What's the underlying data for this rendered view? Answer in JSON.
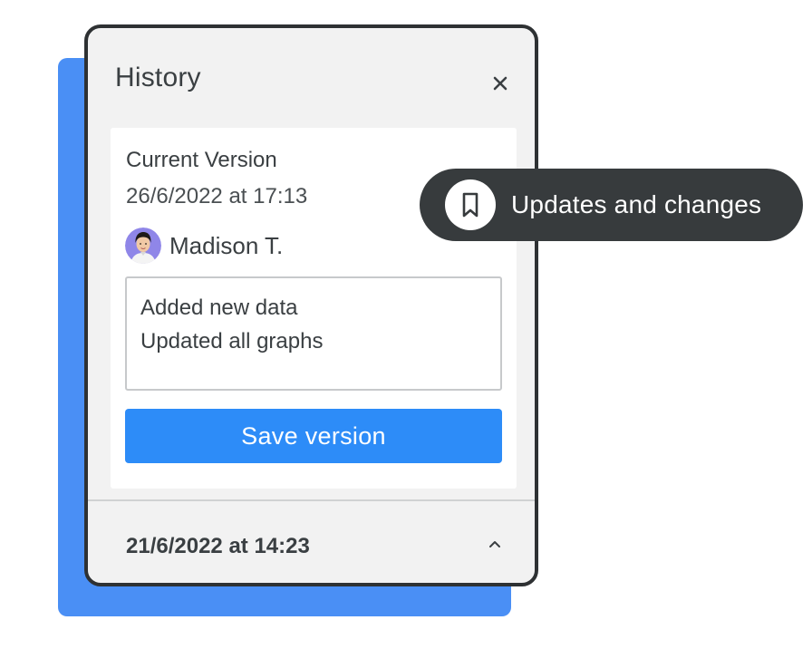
{
  "colors": {
    "backdrop": "#4a8ff5",
    "primary_button": "#2d8cf8",
    "pill_background": "#373b3d",
    "panel_background": "#f2f2f2",
    "panel_border": "#2e3133"
  },
  "panel": {
    "title": "History",
    "close_icon": "close-icon",
    "current_version": {
      "label": "Current Version",
      "date": "26/6/2022 at 17:13",
      "author": {
        "name": "Madison T.",
        "avatar_icon": "avatar"
      },
      "notes": {
        "lines": [
          "Added new data",
          "Updated all graphs"
        ]
      },
      "save_button_label": "Save version"
    },
    "previous_versions": [
      {
        "date": "21/6/2022 at 14:23",
        "toggle_icon": "chevron-up-icon"
      }
    ]
  },
  "tag": {
    "icon": "bookmark-icon",
    "label": "Updates and changes"
  }
}
